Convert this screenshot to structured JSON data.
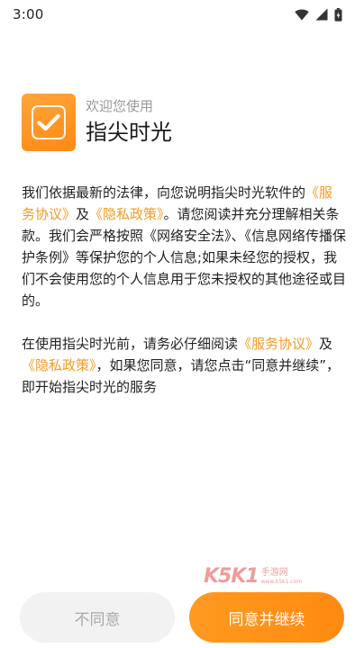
{
  "status_bar": {
    "time": "3:00",
    "icons": [
      "wifi-icon",
      "signal-icon",
      "battery-icon"
    ]
  },
  "header": {
    "logo_icon": "checkmark-icon",
    "welcome": "欢迎您使用",
    "app_name": "指尖时光"
  },
  "content": {
    "p1": {
      "t1": "我们依据最新的法律，向您说明指尖时光软件的",
      "link1": "《服务协议》",
      "t2": "及",
      "link2": "《隐私政策》",
      "t3": "。请您阅读并充分理解相关条款。我们会严格按照《网络安全法》、《信息网络传播保护条例》等保护您的个人信息;如果未经您的授权，我们不会使用您的个人信息用于您未授权的其他途径或目的。"
    },
    "p2": {
      "t1": "在使用指尖时光前，请务必仔细阅读",
      "link1": "《服务协议》",
      "t2": "及",
      "link2": "《隐私政策》",
      "t3": "，如果您同意，请您点击“同意并继续”，即开始指尖时光的服务"
    }
  },
  "watermark": {
    "brand": "K5K1",
    "sub_top": "手游网",
    "sub_bottom": "www.k5k1.com"
  },
  "buttons": {
    "decline": "不同意",
    "accept": "同意并继续"
  },
  "colors": {
    "accent": "#f59a23",
    "button_accept": "#ff8a10",
    "button_decline_bg": "#f2f2f2"
  }
}
